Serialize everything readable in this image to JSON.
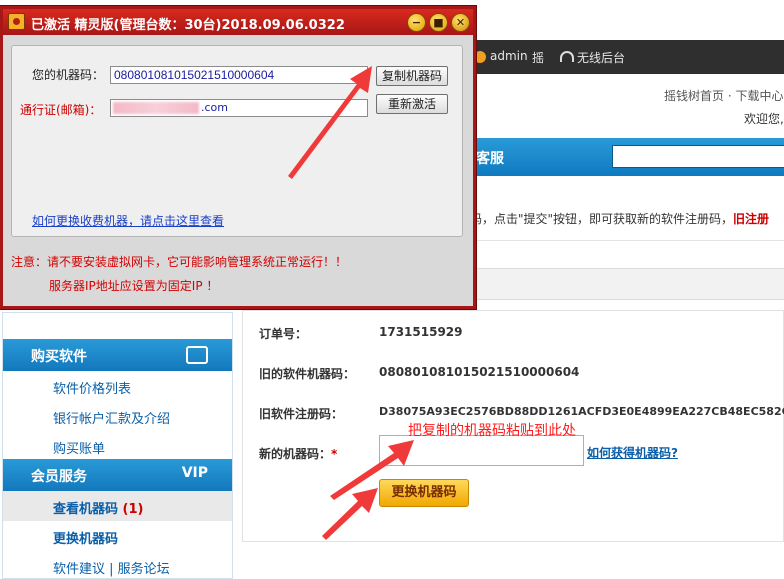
{
  "app_window": {
    "title": "已激活 精灵版(管理台数：30台)2018.09.06.0322",
    "minimize_glyph": "−",
    "maximize_glyph": "■",
    "close_glyph": "✕",
    "machine_code_label": "您的机器码：",
    "machine_code_value": "080801081015021510000604",
    "account_label": "通行证(邮箱)：",
    "account_value_visible": ".com",
    "copy_button": "复制机器码",
    "reactivate_button": "重新激活",
    "help_link": "如何更换收费机器，请点击这里查看",
    "warning_1": "注意：请不要安装虚拟网卡，它可能影响管理系统正常运行！！",
    "warning_2": "服务器IP地址应设置为固定IP ！"
  },
  "topbar": {
    "username": "admin",
    "item_shake": "摇",
    "item_wifi": "无线后台"
  },
  "header": {
    "links": "摇钱树首页 · 下载中心",
    "welcome": "欢迎您,"
  },
  "bluebar": {
    "title": "客服"
  },
  "notice": {
    "text": "码，点击\"提交\"按钮，即可获取新的软件注册码，",
    "emphasis": "旧注册"
  },
  "sidebar": {
    "buy_title": "购买软件",
    "buy_items": [
      "软件价格列表",
      "银行帐户汇款及介绍",
      "购买账单"
    ],
    "member_title": "会员服务",
    "vip": "VIP",
    "member_items": [
      {
        "label": "查看机器码 ",
        "count": "(1)"
      },
      {
        "label": "更换机器码"
      },
      {
        "label": "软件建议 | 服务论坛"
      }
    ]
  },
  "form": {
    "order_label": "订单号：",
    "order_value": "1731515929",
    "old_machine_label": "旧的软件机器码：",
    "old_machine_value": "080801081015021510000604",
    "old_reg_label": "旧软件注册码：",
    "old_reg_value": "D38075A93EC2576BD88DD1261ACFD3E0E4899EA227CB48EC582C",
    "new_machine_label": "新的机器码：",
    "required_mark": "*",
    "new_machine_value": "",
    "how_link": "如何获得机器码?",
    "replace_button": "更换机器码"
  },
  "annotation": {
    "text": "把复制的机器码粘贴到此处",
    "color": "#ff1c1c"
  },
  "colors": {
    "window_frame": "#a81717",
    "blue_accent": "#1278bc",
    "button_gold": "#f0a800"
  }
}
